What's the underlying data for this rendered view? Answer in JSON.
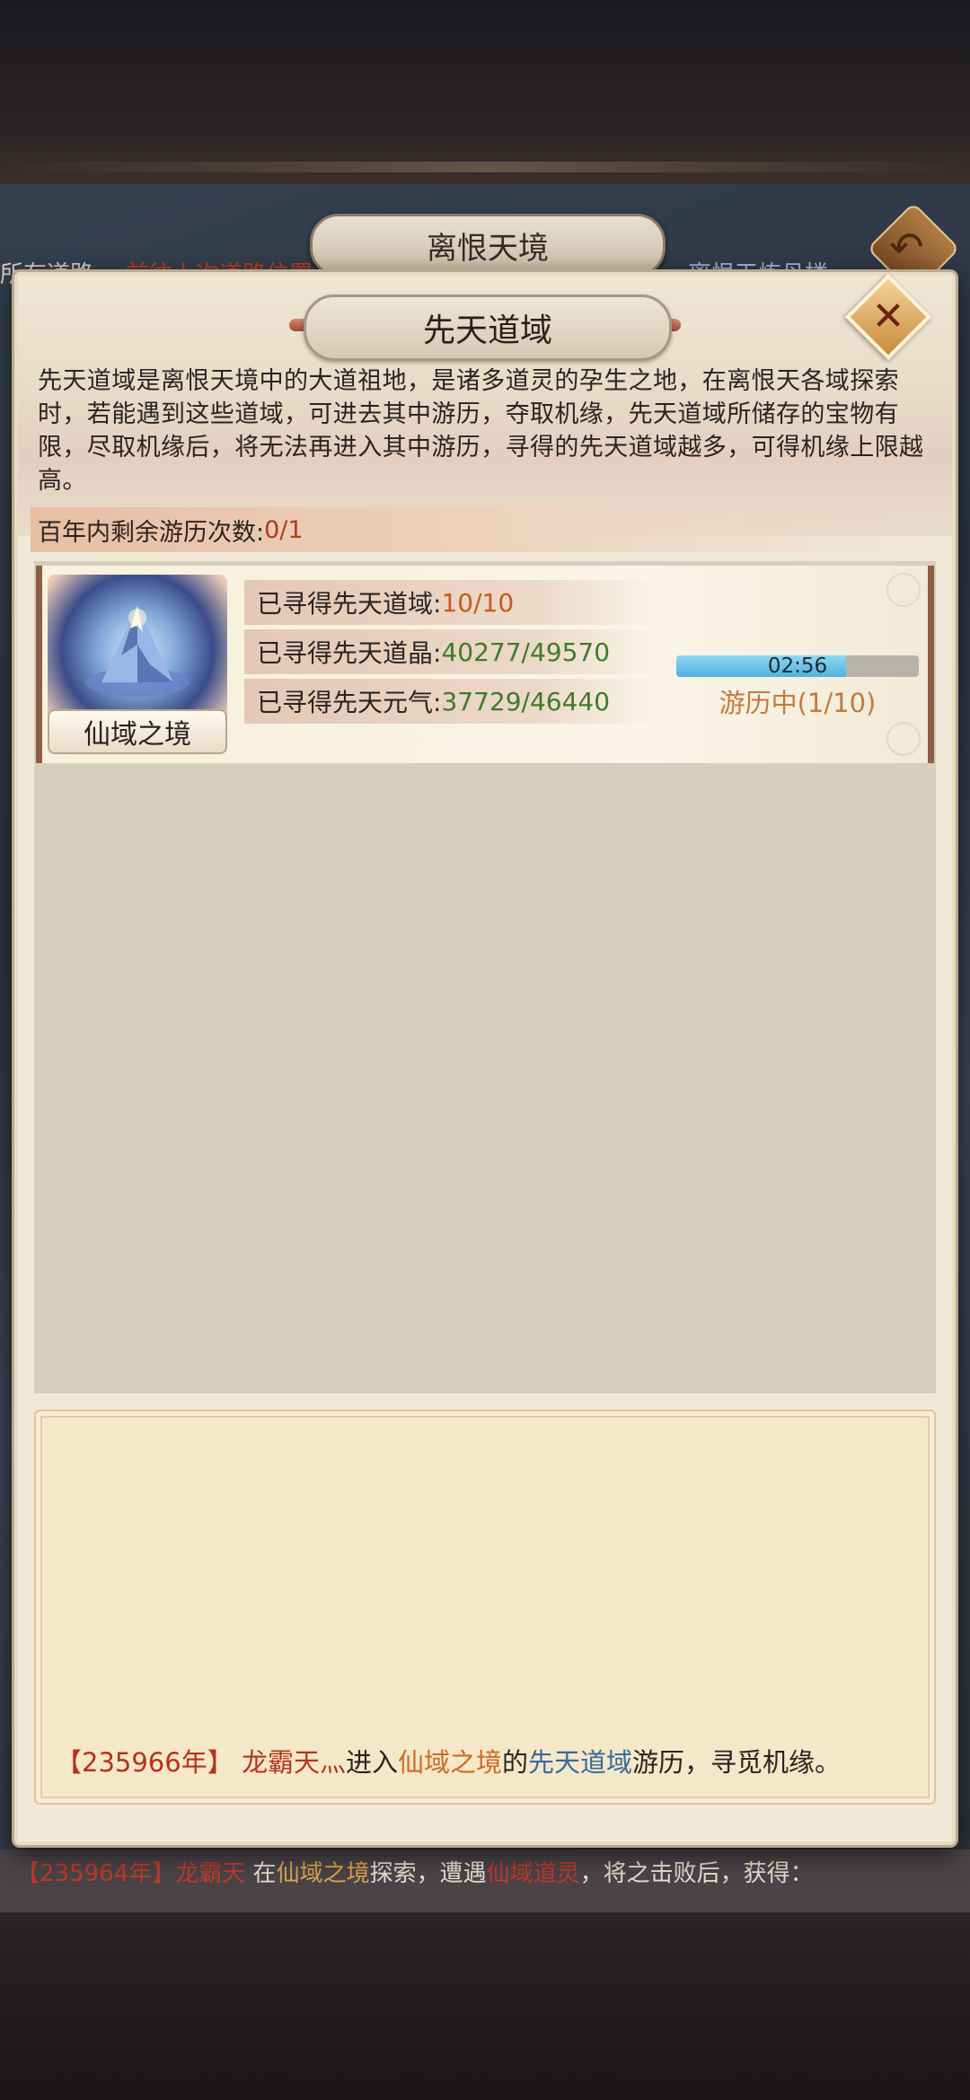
{
  "background": {
    "outer_title": "离恨天境",
    "strip_left": "所有道路",
    "strip_red": "前往上次道路位置",
    "strip_right": "离恨天炼丹楼",
    "log_year": "【235964年】",
    "log_name": "龙霸天",
    "log_mid": "在",
    "log_place": "仙域之境",
    "log_text": "探索，遭遇",
    "log_enemy": "仙域道灵",
    "log_tail": "，将之击败后，获得："
  },
  "panel": {
    "title": "先天道域",
    "close_icon": "close-icon",
    "description": "先天道域是离恨天境中的大道祖地，是诸多道灵的孕生之地，在离恨天各域探索时，若能遇到这些道域，可进去其中游历，夺取机缘，先天道域所储存的宝物有限，尽取机缘后，将无法再进入其中游历，寻得的先天道域越多，可得机缘上限越高。",
    "remaining_label": "百年内剩余游历次数:",
    "remaining_value": "0/1"
  },
  "realm": {
    "name": "仙域之境",
    "thumb_icon": "mountain-icon",
    "stats": [
      {
        "label": "已寻得先天道域:",
        "value": "10/10"
      },
      {
        "label": "已寻得先天道晶:",
        "value": "40277/49570"
      },
      {
        "label": "已寻得先天元气:",
        "value": "37729/46440"
      }
    ],
    "timer": "02:56",
    "progress_fraction": 0.7,
    "status": "游历中(1/10)"
  },
  "log": {
    "year": "【235966年】",
    "name": "龙霸天灬",
    "enter": "进入",
    "place": "仙域之境",
    "of": "的",
    "domain": "先天道域",
    "tail": "游历，寻觅机缘。"
  },
  "colors": {
    "accent_orange": "#c5591f",
    "accent_green": "#3f7a2a",
    "progress_blue": "#4fb1e0",
    "panel_bg": "#f1e9d8"
  }
}
